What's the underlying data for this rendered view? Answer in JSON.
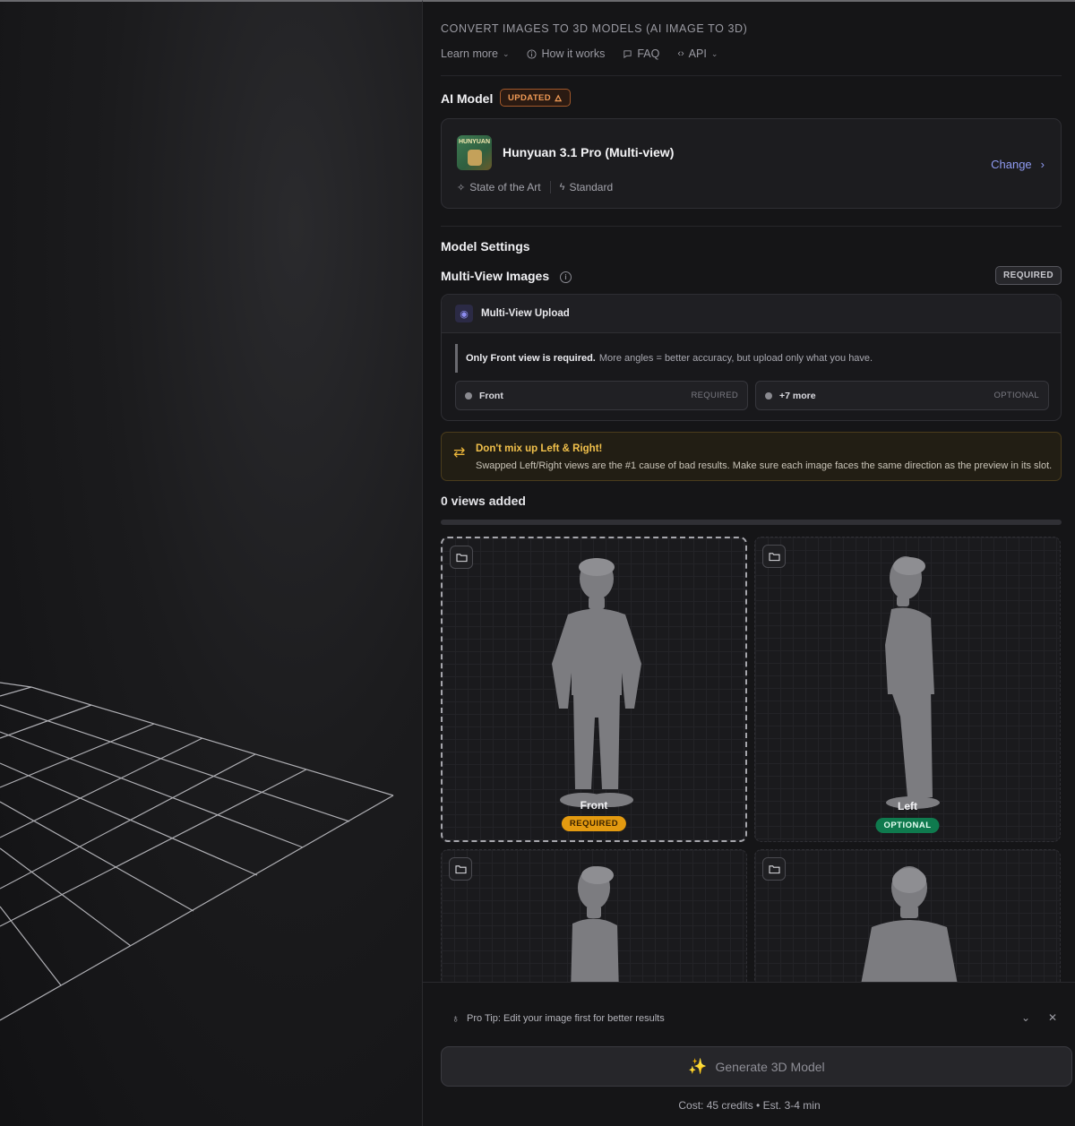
{
  "header": {
    "title": "CONVERT IMAGES TO 3D MODELS (AI IMAGE TO 3D)",
    "links": [
      {
        "label": "Learn more",
        "icon": "none",
        "has_chevron": true
      },
      {
        "label": "How it works",
        "icon": "info-icon",
        "has_chevron": false
      },
      {
        "label": "FAQ",
        "icon": "chat-bubble-icon",
        "has_chevron": false
      },
      {
        "label": "API",
        "icon": "code-icon",
        "has_chevron": true
      }
    ]
  },
  "ai_model": {
    "section_title": "AI Model",
    "badge": "UPDATED",
    "thumb_text": "HUNYUAN",
    "name": "Hunyuan 3.1 Pro (Multi-view)",
    "tags": [
      "State of the Art",
      "Standard"
    ],
    "change_label": "Change"
  },
  "settings": {
    "section_title": "Model Settings",
    "multiview_title": "Multi-View Images",
    "required_badge": "REQUIRED",
    "upload_title": "Multi-View Upload",
    "note_bold": "Only Front view is required.",
    "note_text": "More angles = better accuracy, but upload only what you have.",
    "slots": [
      {
        "label": "Front",
        "status": "REQUIRED"
      },
      {
        "label": "+7 more",
        "status": "OPTIONAL"
      }
    ]
  },
  "warning": {
    "title": "Don't mix up Left & Right!",
    "text": "Swapped Left/Right views are the #1 cause of bad results. Make sure each image faces the same direction as the preview in its slot.",
    "color": "#f2c14b"
  },
  "views": {
    "count_label": "0 views added",
    "progress": 0,
    "cards": [
      {
        "label": "Front",
        "status": "REQUIRED"
      },
      {
        "label": "Left",
        "status": "OPTIONAL"
      }
    ]
  },
  "footer": {
    "pro_tip": "Pro Tip: Edit your image first for better results",
    "generate_label": "Generate 3D Model",
    "cost": "Cost: 45 credits • Est. 3-4 min"
  },
  "colors": {
    "accent": "#8f9bf2",
    "required": "#e39a10",
    "optional": "#0f7a4e",
    "updated": "#f09a55"
  }
}
